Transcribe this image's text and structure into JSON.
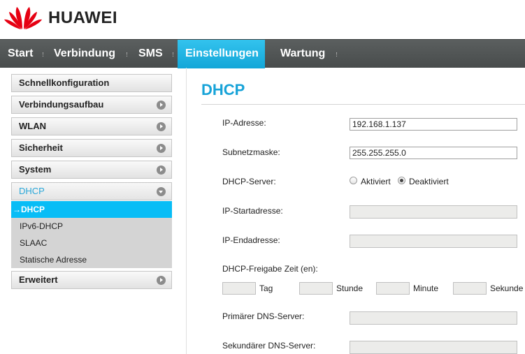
{
  "brand": {
    "name": "HUAWEI",
    "logo_icon": "huawei-petal-logo-icon",
    "logo_color": "#e60012"
  },
  "nav": {
    "items": [
      {
        "label": "Start",
        "active": false
      },
      {
        "label": "Verbindung",
        "active": false
      },
      {
        "label": "SMS",
        "active": false
      },
      {
        "label": "Einstellungen",
        "active": true
      },
      {
        "label": "Wartung",
        "active": false
      }
    ],
    "active_color": "#1fb3e6"
  },
  "sidebar": {
    "items": [
      {
        "label": "Schnellkonfiguration",
        "has_arrow": false
      },
      {
        "label": "Verbindungsaufbau",
        "has_arrow": true
      },
      {
        "label": "WLAN",
        "has_arrow": true
      },
      {
        "label": "Sicherheit",
        "has_arrow": true
      },
      {
        "label": "System",
        "has_arrow": true
      },
      {
        "label": "DHCP",
        "has_arrow": true,
        "expanded": true
      },
      {
        "label": "Erweitert",
        "has_arrow": true
      }
    ],
    "sub_items": [
      {
        "label": "→DHCP",
        "active": true
      },
      {
        "label": "IPv6-DHCP",
        "active": false
      },
      {
        "label": "SLAAC",
        "active": false
      },
      {
        "label": "Statische Adresse",
        "active": false
      }
    ]
  },
  "main": {
    "title": "DHCP",
    "ip_address": {
      "label": "IP-Adresse:",
      "value": "192.168.1.137"
    },
    "subnet_mask": {
      "label": "Subnetzmaske:",
      "value": "255.255.255.0"
    },
    "dhcp_server": {
      "label": "DHCP-Server:",
      "options": [
        {
          "label": "Aktiviert",
          "checked": false
        },
        {
          "label": "Deaktiviert",
          "checked": true
        }
      ]
    },
    "start_address": {
      "label": "IP-Startadresse:",
      "value": ""
    },
    "end_address": {
      "label": "IP-Endadresse:",
      "value": ""
    },
    "lease_time": {
      "label": "DHCP-Freigabe Zeit (en):",
      "units": [
        "Tag",
        "Stunde",
        "Minute",
        "Sekunde"
      ]
    },
    "primary_dns": {
      "label": "Primärer DNS-Server:",
      "value": ""
    },
    "secondary_dns": {
      "label": "Sekundärer DNS-Server:",
      "value": ""
    }
  }
}
